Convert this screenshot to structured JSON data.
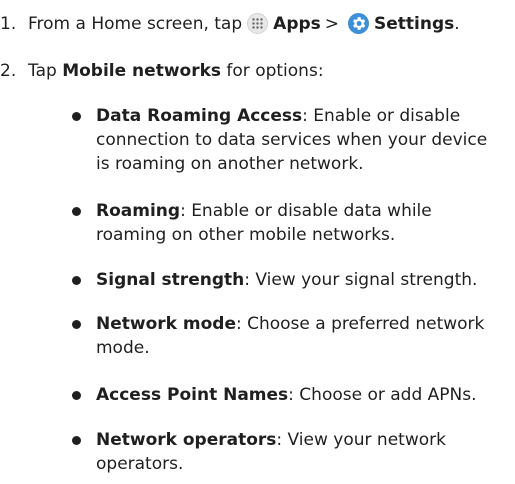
{
  "steps": [
    {
      "number": "1.",
      "prefix": "From a Home screen, tap",
      "apps_icon": "apps-grid-icon",
      "apps_label": "Apps",
      "separator": ">",
      "settings_icon": "gear-icon",
      "settings_label": "Settings",
      "suffix": "."
    },
    {
      "number": "2.",
      "prefix": "Tap",
      "label": "Mobile networks",
      "suffix": "for options:"
    }
  ],
  "options": [
    {
      "term": "Data Roaming Access",
      "desc": ": Enable or disable connection to data services when your device is roaming on another network."
    },
    {
      "term": "Roaming",
      "desc": ": Enable or disable data while roaming on other mobile networks."
    },
    {
      "term": "Signal strength",
      "desc": ": View your signal strength."
    },
    {
      "term": "Network mode",
      "desc": ": Choose a preferred network mode."
    },
    {
      "term": "Access Point Names",
      "desc": ": Choose or add APNs."
    },
    {
      "term": "Network operators",
      "desc": ": View your network operators."
    }
  ],
  "colors": {
    "text": "#1f1f1f",
    "settings_icon_bg": "#3d8fd6",
    "apps_icon_bg": "#e8e8e8"
  }
}
